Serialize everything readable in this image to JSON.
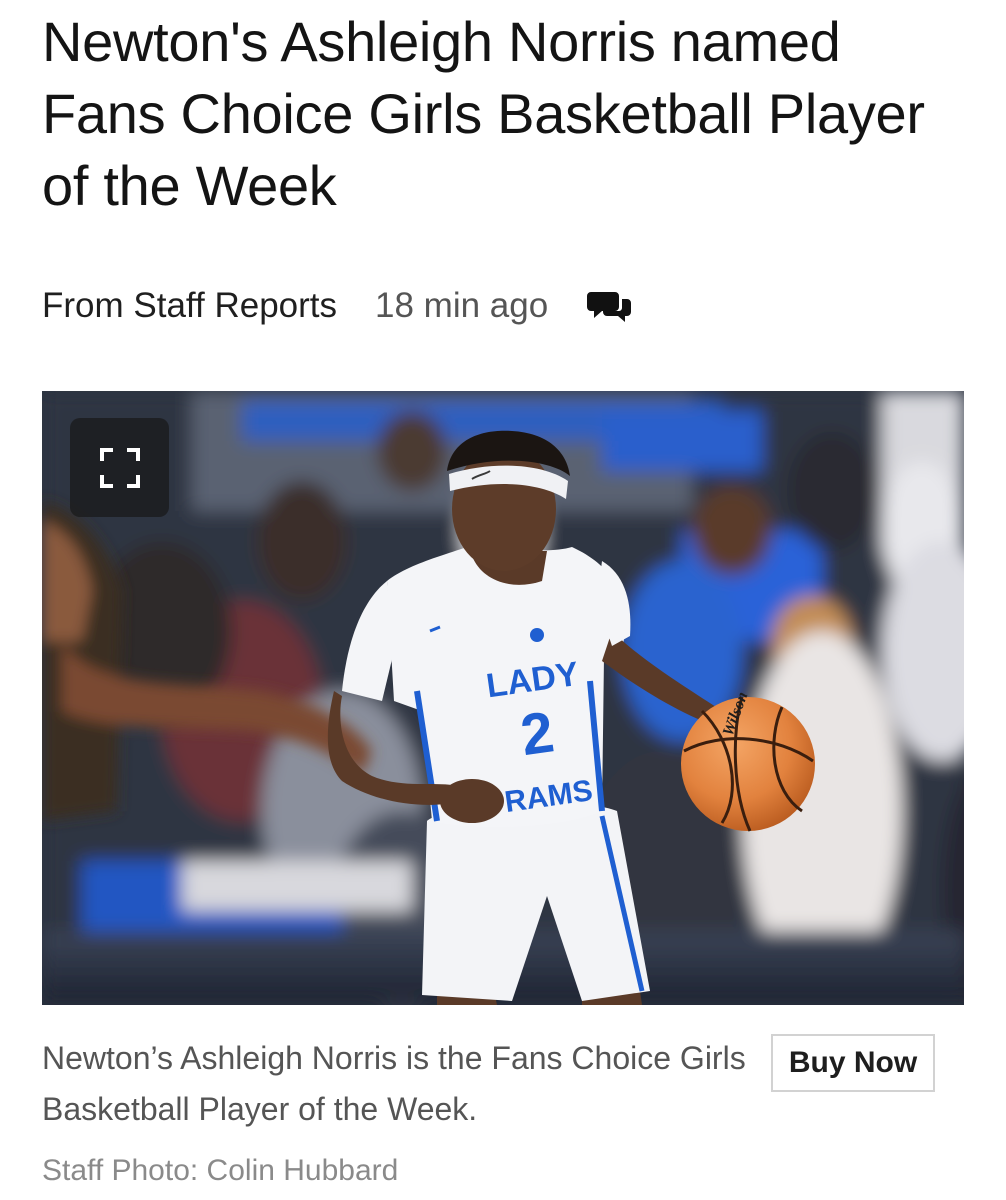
{
  "article": {
    "headline": "Newton's Ashleigh Norris named Fans Choice Girls Basketball Player of the Week",
    "author": "From Staff Reports",
    "time_ago": "18 min ago",
    "comments_icon": "comments-icon"
  },
  "photo": {
    "expand_icon": "expand-icon",
    "jersey": {
      "line1": "LADY",
      "number": "2",
      "line2": "RAMS"
    },
    "ball_brand": "Wilson",
    "caption": "Newton’s Ashleigh Norris is the Fans Choice Girls Basketball Player of the Week.",
    "credit": "Staff Photo: Colin Hubbard"
  },
  "actions": {
    "buy_label": "Buy Now"
  },
  "colors": {
    "jersey_blue": "#1f5fd1",
    "ball_orange": "#e2823e",
    "seat_blue": "#2457b8"
  }
}
